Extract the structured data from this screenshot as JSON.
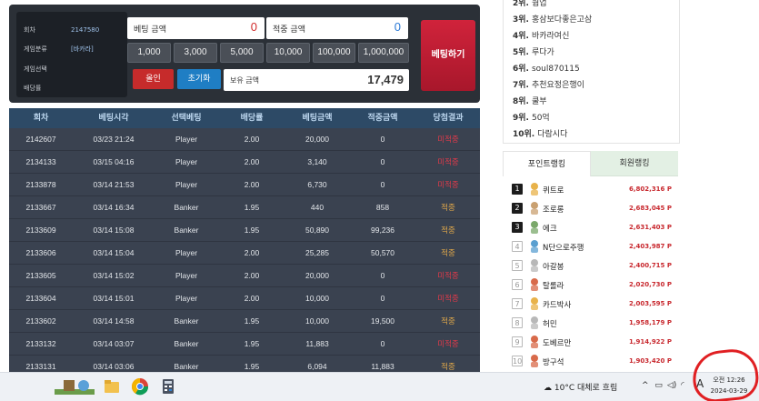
{
  "bet_panel": {
    "info": [
      {
        "label": "회차",
        "value": "2147580"
      },
      {
        "label": "게임분류",
        "value": "[바카라]"
      },
      {
        "label": "게임선택",
        "value": ""
      },
      {
        "label": "배당률",
        "value": ""
      }
    ],
    "bet_amount_label": "베팅 금액",
    "bet_amount_value": "0",
    "win_amount_label": "적중 금액",
    "win_amount_value": "0",
    "chips": [
      "1,000",
      "3,000",
      "5,000",
      "10,000",
      "100,000",
      "1,000,000"
    ],
    "all_in_label": "올인",
    "reset_label": "초기화",
    "hold_label": "보유 금액",
    "hold_value": "17,479",
    "bet_button_label": "베팅하기",
    "colors": {
      "bet_button": "#c21e33",
      "all_in": "#c62b2b",
      "reset": "#1f7ec4"
    }
  },
  "history": {
    "headers": [
      "회차",
      "베팅시각",
      "선택베팅",
      "배당률",
      "베팅금액",
      "적중금액",
      "당첨결과"
    ],
    "rows": [
      [
        "2142607",
        "03/23 21:24",
        "Player",
        "2.00",
        "20,000",
        "0",
        "미적중"
      ],
      [
        "2134133",
        "03/15 04:16",
        "Player",
        "2.00",
        "3,140",
        "0",
        "미적중"
      ],
      [
        "2133878",
        "03/14 21:53",
        "Player",
        "2.00",
        "6,730",
        "0",
        "미적중"
      ],
      [
        "2133667",
        "03/14 16:34",
        "Banker",
        "1.95",
        "440",
        "858",
        "적중"
      ],
      [
        "2133609",
        "03/14 15:08",
        "Banker",
        "1.95",
        "50,890",
        "99,236",
        "적중"
      ],
      [
        "2133606",
        "03/14 15:04",
        "Player",
        "2.00",
        "25,285",
        "50,570",
        "적중"
      ],
      [
        "2133605",
        "03/14 15:02",
        "Player",
        "2.00",
        "20,000",
        "0",
        "미적중"
      ],
      [
        "2133604",
        "03/14 15:01",
        "Player",
        "2.00",
        "10,000",
        "0",
        "미적중"
      ],
      [
        "2133602",
        "03/14 14:58",
        "Banker",
        "1.95",
        "10,000",
        "19,500",
        "적중"
      ],
      [
        "2133132",
        "03/14 03:07",
        "Banker",
        "1.95",
        "11,883",
        "0",
        "미적중"
      ],
      [
        "2133131",
        "03/14 03:06",
        "Banker",
        "1.95",
        "6,094",
        "11,883",
        "적중"
      ]
    ]
  },
  "rank_list": [
    {
      "no": "2위.",
      "name": "웜업"
    },
    {
      "no": "3위.",
      "name": "홍삼보다좋은고삼"
    },
    {
      "no": "4위.",
      "name": "바카라여신"
    },
    {
      "no": "5위.",
      "name": "루다가"
    },
    {
      "no": "6위.",
      "name": "soul870115"
    },
    {
      "no": "7위.",
      "name": "추천요정은행이"
    },
    {
      "no": "8위.",
      "name": "쿨부"
    },
    {
      "no": "9위.",
      "name": "50억"
    },
    {
      "no": "10위.",
      "name": "다람시다"
    }
  ],
  "tabs": [
    "포인트랭킹",
    "회원랭킹"
  ],
  "point_ranking": [
    {
      "rank": "1",
      "name": "퀴트로",
      "points": "6,802,316 P"
    },
    {
      "rank": "2",
      "name": "조로롱",
      "points": "2,683,045 P"
    },
    {
      "rank": "3",
      "name": "에크",
      "points": "2,631,403 P"
    },
    {
      "rank": "4",
      "name": "N단으로주행",
      "points": "2,403,987 P"
    },
    {
      "rank": "5",
      "name": "아갈봉",
      "points": "2,400,715 P"
    },
    {
      "rank": "6",
      "name": "탈롤라",
      "points": "2,020,730 P"
    },
    {
      "rank": "7",
      "name": "카드박사",
      "points": "2,003,595 P"
    },
    {
      "rank": "8",
      "name": "허민",
      "points": "1,958,179 P"
    },
    {
      "rank": "9",
      "name": "도베르만",
      "points": "1,914,922 P"
    },
    {
      "rank": "10",
      "name": "방구석",
      "points": "1,903,420 P"
    }
  ],
  "taskbar": {
    "weather": "10°C  대체로 흐림",
    "ime": "A",
    "time": "오전 12:26",
    "date": "2024-03-29",
    "apps": [
      "folder-app-icon",
      "chrome-app-icon",
      "calculator-app-icon"
    ]
  }
}
